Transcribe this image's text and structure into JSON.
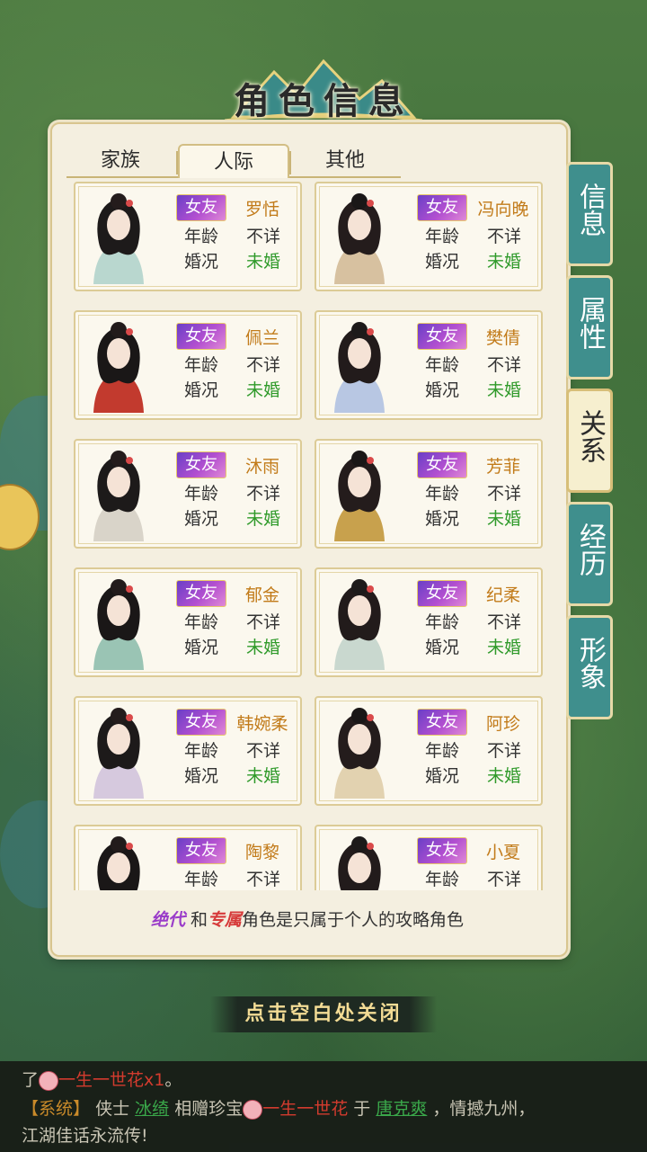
{
  "title": "角色信息",
  "tabs": [
    {
      "label": "家族",
      "active": false
    },
    {
      "label": "人际",
      "active": true
    },
    {
      "label": "其他",
      "active": false
    }
  ],
  "labels": {
    "age": "年龄",
    "marriage": "婚况"
  },
  "characters": [
    {
      "badge": "女友",
      "name": "罗恬",
      "age": "不详",
      "marriage": "未婚"
    },
    {
      "badge": "女友",
      "name": "冯向晚",
      "age": "不详",
      "marriage": "未婚"
    },
    {
      "badge": "女友",
      "name": "佩兰",
      "age": "不详",
      "marriage": "未婚"
    },
    {
      "badge": "女友",
      "name": "樊倩",
      "age": "不详",
      "marriage": "未婚"
    },
    {
      "badge": "女友",
      "name": "沐雨",
      "age": "不详",
      "marriage": "未婚"
    },
    {
      "badge": "女友",
      "name": "芳菲",
      "age": "不详",
      "marriage": "未婚"
    },
    {
      "badge": "女友",
      "name": "郁金",
      "age": "不详",
      "marriage": "未婚"
    },
    {
      "badge": "女友",
      "name": "纪柔",
      "age": "不详",
      "marriage": "未婚"
    },
    {
      "badge": "女友",
      "name": "韩婉柔",
      "age": "不详",
      "marriage": "未婚"
    },
    {
      "badge": "女友",
      "name": "阿珍",
      "age": "不详",
      "marriage": "未婚"
    },
    {
      "badge": "女友",
      "name": "陶黎",
      "age": "不详",
      "marriage": ""
    },
    {
      "badge": "女友",
      "name": "小夏",
      "age": "不详",
      "marriage": ""
    }
  ],
  "note": {
    "part1": "绝代",
    "and": "和",
    "part2": "专属",
    "rest": "角色是只属于个人的攻略角色"
  },
  "side_tabs": [
    {
      "label": "信息",
      "active": false
    },
    {
      "label": "属性",
      "active": false
    },
    {
      "label": "关系",
      "active": true
    },
    {
      "label": "经历",
      "active": false
    },
    {
      "label": "形象",
      "active": false
    }
  ],
  "close_hint": "点击空白处关闭",
  "chat": {
    "line1_prefix": "了",
    "line1_item": "一生一世花x1",
    "line1_end": "。",
    "line2_tag": "【系统】",
    "line2_a": "侠士",
    "line2_user1": "冰绮",
    "line2_b": "相赠珍宝",
    "line2_item": "一生一世花",
    "line2_c": "于",
    "line2_user2": "唐克爽",
    "line2_d": "，情撼九州，",
    "line3": "江湖佳话永流传!"
  },
  "colors": {
    "panel": "#f4efe0",
    "side_tab": "#3f8f8d",
    "name": "#c27b1a",
    "unmarried": "#2f9a2a",
    "badge_start": "#6a3fc7",
    "badge_end": "#e08ad6"
  }
}
